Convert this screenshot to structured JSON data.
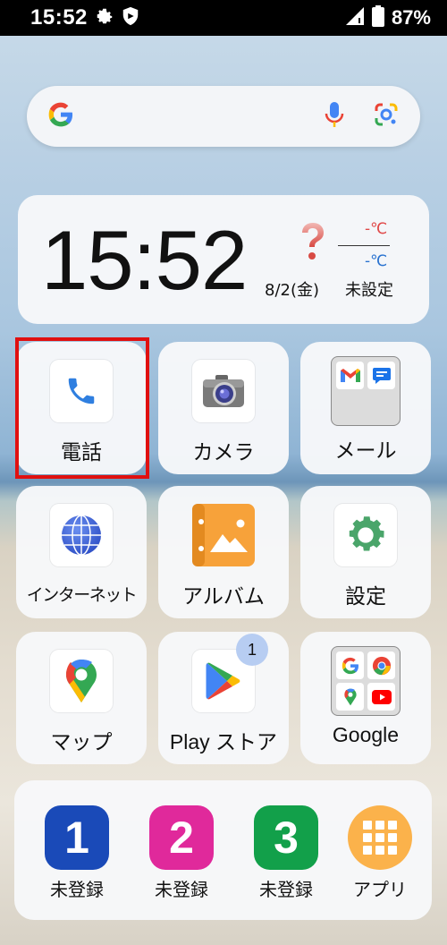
{
  "status_bar": {
    "time": "15:52",
    "icons": [
      "gear-icon",
      "shield-icon",
      "signal-icon",
      "battery-icon"
    ],
    "battery": "87%"
  },
  "search": {
    "logo": "G",
    "icons": [
      "google-logo-icon",
      "microphone-icon",
      "google-lens-icon"
    ]
  },
  "clock_widget": {
    "time": "15:52",
    "date": "8/2(金)",
    "weather_icon": "question-mark-icon",
    "temp_high": "-℃",
    "temp_low": "-℃",
    "location": "未設定"
  },
  "apps": [
    {
      "label": "電話",
      "icon": "phone-icon"
    },
    {
      "label": "カメラ",
      "icon": "camera-icon"
    },
    {
      "label": "メール",
      "icon": "mail-folder-icon"
    },
    {
      "label": "インターネット",
      "icon": "globe-icon"
    },
    {
      "label": "アルバム",
      "icon": "album-icon"
    },
    {
      "label": "設定",
      "icon": "settings-gear-icon"
    },
    {
      "label": "マップ",
      "icon": "maps-pin-icon"
    },
    {
      "label": "Play ストア",
      "icon": "play-store-icon",
      "badge": "1"
    },
    {
      "label": "Google",
      "icon": "google-folder-icon"
    }
  ],
  "dock": {
    "speed_dials": [
      {
        "number": "1",
        "label": "未登録",
        "color": "#1a4ab8"
      },
      {
        "number": "2",
        "label": "未登録",
        "color": "#e0299b"
      },
      {
        "number": "3",
        "label": "未登録",
        "color": "#12a04a"
      }
    ],
    "apps_label": "アプリ",
    "apps_color": "#fbb24b"
  },
  "highlight_color": "#e01010"
}
